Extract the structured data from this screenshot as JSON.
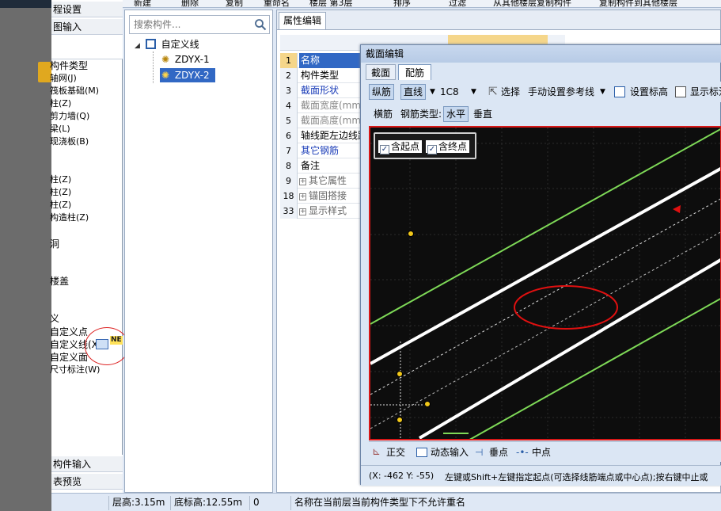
{
  "toolbar": {
    "items": [
      "新建",
      "删除",
      "复制",
      "重命名",
      "楼层 第3层",
      "排序",
      "过滤",
      "从其他楼层复制构件",
      "复制构件到其他楼层"
    ]
  },
  "left_panel": {
    "header_top1": "程设置",
    "header_top2": "图输入",
    "tree_items": [
      "构件类型",
      "轴网(J)",
      "筏板基础(M)",
      "柱(Z)",
      "剪力墙(Q)",
      "梁(L)",
      "现浇板(B)",
      "柱(Z)",
      "柱(Z)",
      "柱(Z)",
      "构造柱(Z)",
      "洞",
      "楼盖",
      "义",
      "自定义点",
      "自定义线(X)",
      "自定义面",
      "尺寸标注(W)"
    ],
    "badge_text": "NE",
    "footer1": "构件输入",
    "footer2": "表预览"
  },
  "mid_panel": {
    "search_placeholder": "搜索构件...",
    "tree_root": "自定义线",
    "children": [
      "ZDYX-1",
      "ZDYX-2"
    ]
  },
  "prop_panel": {
    "tab_label": "属性编辑",
    "rows": [
      {
        "num": "1",
        "name": "名称",
        "style": "selected"
      },
      {
        "num": "2",
        "name": "构件类型",
        "style": "normal"
      },
      {
        "num": "3",
        "name": "截面形状",
        "style": "link"
      },
      {
        "num": "4",
        "name": "截面宽度(mm)",
        "style": "gray"
      },
      {
        "num": "5",
        "name": "截面高度(mm)",
        "style": "gray"
      },
      {
        "num": "6",
        "name": "轴线距左边线距离",
        "style": "normal"
      },
      {
        "num": "7",
        "name": "其它钢筋",
        "style": "link"
      },
      {
        "num": "8",
        "name": "备注",
        "style": "normal"
      },
      {
        "num": "9",
        "name": "其它属性",
        "style": "group"
      },
      {
        "num": "18",
        "name": "锚固搭接",
        "style": "group"
      },
      {
        "num": "33",
        "name": "显示样式",
        "style": "group"
      }
    ]
  },
  "dialog": {
    "title": "截面编辑",
    "tabs": [
      "截面",
      "配筋"
    ],
    "toolbar1": {
      "longitudinal": "纵筋",
      "straight": "直线",
      "rebar_spec": "1C8",
      "select": "选择",
      "manual_ref": "手动设置参考线",
      "set_elevation": "设置标高",
      "show_label": "显示标注"
    },
    "toolbar2": {
      "transverse": "横筋",
      "rebar_type_label": "钢筋类型:",
      "horizontal": "水平",
      "vertical": "垂直"
    },
    "snap_popup": {
      "start_point": "含起点",
      "end_point": "含终点"
    },
    "snap_bar": {
      "orthogonal": "正交",
      "dynamic_input": "动态输入",
      "perpendicular": "垂点",
      "midpoint": "中点"
    },
    "coords": "(X: -462 Y: -55)",
    "hint": "左键或Shift+左键指定起点(可选择线筋端点或中心点);按右键中止或"
  },
  "status_bar": {
    "floor_height": "层高:3.15m",
    "base_elevation": "底标高:12.55m",
    "zero": "0",
    "message": "名称在当前层当前构件类型下不允许重名"
  },
  "colors": {
    "canvas_bg": "#0d0d0d",
    "canvas_border": "#d81818",
    "green_line": "#7ed957",
    "white_line": "#ffffff",
    "point_yellow": "#f2c81a",
    "annotation_red": "#e01010"
  }
}
